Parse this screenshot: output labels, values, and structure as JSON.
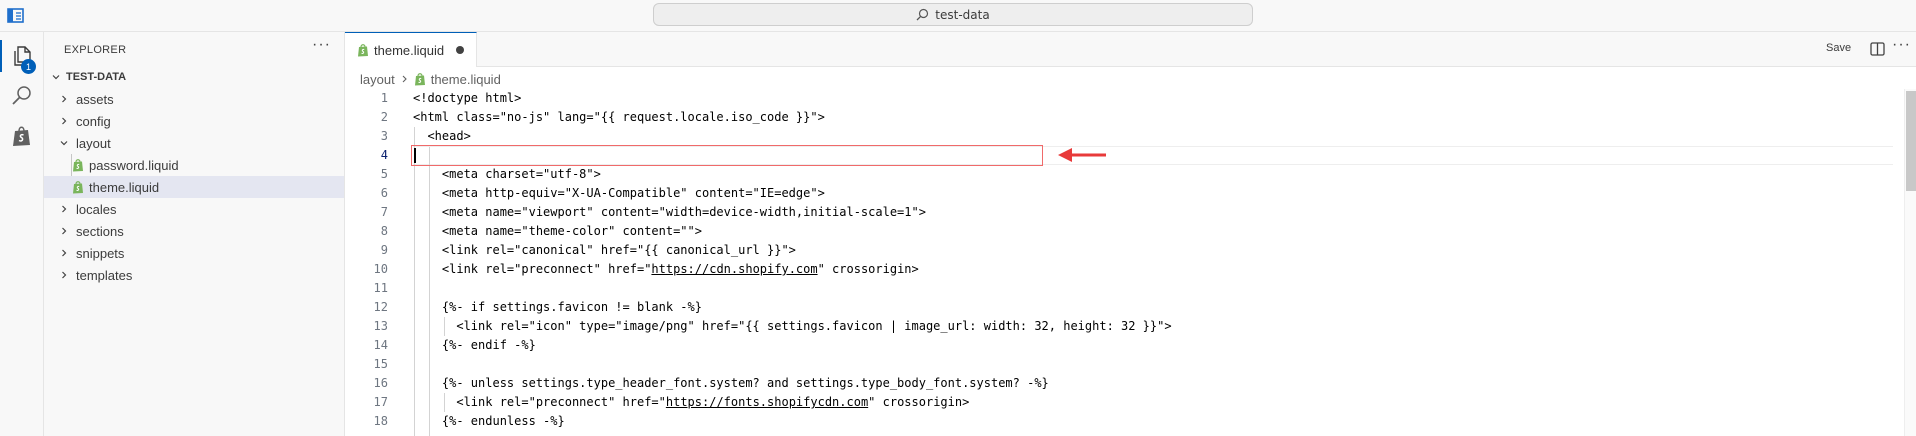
{
  "titlebar": {
    "search_text": "test-data"
  },
  "activity": {
    "explorer_badge": "1"
  },
  "explorer": {
    "title": "EXPLORER",
    "more": "···",
    "folder": "TEST-DATA",
    "items": [
      {
        "label": "assets"
      },
      {
        "label": "config"
      },
      {
        "label": "layout"
      },
      {
        "label": "password.liquid"
      },
      {
        "label": "theme.liquid"
      },
      {
        "label": "locales"
      },
      {
        "label": "sections"
      },
      {
        "label": "snippets"
      },
      {
        "label": "templates"
      }
    ]
  },
  "tab": {
    "label": "theme.liquid"
  },
  "toolbar": {
    "save_label": "Save",
    "more": "···"
  },
  "breadcrumb": {
    "folder": "layout",
    "file": "theme.liquid"
  },
  "editor": {
    "cursor_line": 4,
    "lines": [
      {
        "n": "1",
        "text": "<!doctype html>"
      },
      {
        "n": "2",
        "text": "<html class=\"no-js\" lang=\"{{ request.locale.iso_code }}\">"
      },
      {
        "n": "3",
        "text": "  <head>"
      },
      {
        "n": "4",
        "text": ""
      },
      {
        "n": "5",
        "text": "    <meta charset=\"utf-8\">"
      },
      {
        "n": "6",
        "text": "    <meta http-equiv=\"X-UA-Compatible\" content=\"IE=edge\">"
      },
      {
        "n": "7",
        "text": "    <meta name=\"viewport\" content=\"width=device-width,initial-scale=1\">"
      },
      {
        "n": "8",
        "text": "    <meta name=\"theme-color\" content=\"\">"
      },
      {
        "n": "9",
        "text": "    <link rel=\"canonical\" href=\"{{ canonical_url }}\">"
      },
      {
        "n": "10",
        "pre": "    <link rel=\"preconnect\" href=\"",
        "link": "https://cdn.shopify.com",
        "post": "\" crossorigin>"
      },
      {
        "n": "11",
        "text": ""
      },
      {
        "n": "12",
        "text": "    {%- if settings.favicon != blank -%}"
      },
      {
        "n": "13",
        "text": "      <link rel=\"icon\" type=\"image/png\" href=\"{{ settings.favicon | image_url: width: 32, height: 32 }}\">"
      },
      {
        "n": "14",
        "text": "    {%- endif -%}"
      },
      {
        "n": "15",
        "text": ""
      },
      {
        "n": "16",
        "text": "    {%- unless settings.type_header_font.system? and settings.type_body_font.system? -%}"
      },
      {
        "n": "17",
        "pre": "      <link rel=\"preconnect\" href=\"",
        "link": "https://fonts.shopifycdn.com",
        "post": "\" crossorigin>"
      },
      {
        "n": "18",
        "text": "    {%- endunless -%}"
      }
    ]
  },
  "colors": {
    "accent": "#005fb8",
    "annotation": "#e83a3a"
  }
}
